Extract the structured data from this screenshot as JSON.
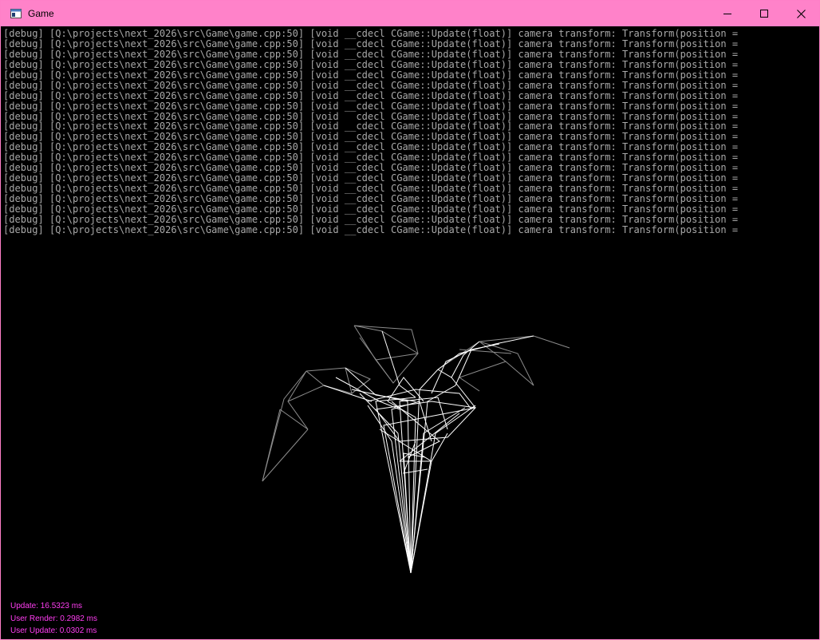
{
  "window": {
    "title": "Game",
    "accent_color": "#ff82c9",
    "icons": {
      "app": "console-app-icon",
      "minimize": "minimize-icon",
      "maximize": "maximize-icon",
      "close": "close-icon"
    }
  },
  "console": {
    "text_color": "#a8a8a8",
    "lines": [
      "[debug] [Q:\\projects\\next_2026\\src\\Game\\game.cpp:50] [void __cdecl CGame::Update(float)] camera transform: Transform(position =",
      "[debug] [Q:\\projects\\next_2026\\src\\Game\\game.cpp:50] [void __cdecl CGame::Update(float)] camera transform: Transform(position =",
      "[debug] [Q:\\projects\\next_2026\\src\\Game\\game.cpp:50] [void __cdecl CGame::Update(float)] camera transform: Transform(position =",
      "[debug] [Q:\\projects\\next_2026\\src\\Game\\game.cpp:50] [void __cdecl CGame::Update(float)] camera transform: Transform(position =",
      "[debug] [Q:\\projects\\next_2026\\src\\Game\\game.cpp:50] [void __cdecl CGame::Update(float)] camera transform: Transform(position =",
      "[debug] [Q:\\projects\\next_2026\\src\\Game\\game.cpp:50] [void __cdecl CGame::Update(float)] camera transform: Transform(position =",
      "[debug] [Q:\\projects\\next_2026\\src\\Game\\game.cpp:50] [void __cdecl CGame::Update(float)] camera transform: Transform(position =",
      "[debug] [Q:\\projects\\next_2026\\src\\Game\\game.cpp:50] [void __cdecl CGame::Update(float)] camera transform: Transform(position =",
      "[debug] [Q:\\projects\\next_2026\\src\\Game\\game.cpp:50] [void __cdecl CGame::Update(float)] camera transform: Transform(position =",
      "[debug] [Q:\\projects\\next_2026\\src\\Game\\game.cpp:50] [void __cdecl CGame::Update(float)] camera transform: Transform(position =",
      "[debug] [Q:\\projects\\next_2026\\src\\Game\\game.cpp:50] [void __cdecl CGame::Update(float)] camera transform: Transform(position =",
      "[debug] [Q:\\projects\\next_2026\\src\\Game\\game.cpp:50] [void __cdecl CGame::Update(float)] camera transform: Transform(position =",
      "[debug] [Q:\\projects\\next_2026\\src\\Game\\game.cpp:50] [void __cdecl CGame::Update(float)] camera transform: Transform(position =",
      "[debug] [Q:\\projects\\next_2026\\src\\Game\\game.cpp:50] [void __cdecl CGame::Update(float)] camera transform: Transform(position =",
      "[debug] [Q:\\projects\\next_2026\\src\\Game\\game.cpp:50] [void __cdecl CGame::Update(float)] camera transform: Transform(position =",
      "[debug] [Q:\\projects\\next_2026\\src\\Game\\game.cpp:50] [void __cdecl CGame::Update(float)] camera transform: Transform(position =",
      "[debug] [Q:\\projects\\next_2026\\src\\Game\\game.cpp:50] [void __cdecl CGame::Update(float)] camera transform: Transform(position =",
      "[debug] [Q:\\projects\\next_2026\\src\\Game\\game.cpp:50] [void __cdecl CGame::Update(float)] camera transform: Transform(position =",
      "[debug] [Q:\\projects\\next_2026\\src\\Game\\game.cpp:50] [void __cdecl CGame::Update(float)] camera transform: Transform(position =",
      "[debug] [Q:\\projects\\next_2026\\src\\Game\\game.cpp:50] [void __cdecl CGame::Update(float)] camera transform: Transform(position ="
    ]
  },
  "scene": {
    "object": "wireframe-plant",
    "line_color": "#ffffff",
    "dim_line_color": "#8c8c8c"
  },
  "stats": {
    "color": "#ff3df2",
    "update": "Update: 16.5323 ms",
    "user_render": "User Render: 0.2982 ms",
    "user_update": "User Update: 0.0302 ms"
  }
}
